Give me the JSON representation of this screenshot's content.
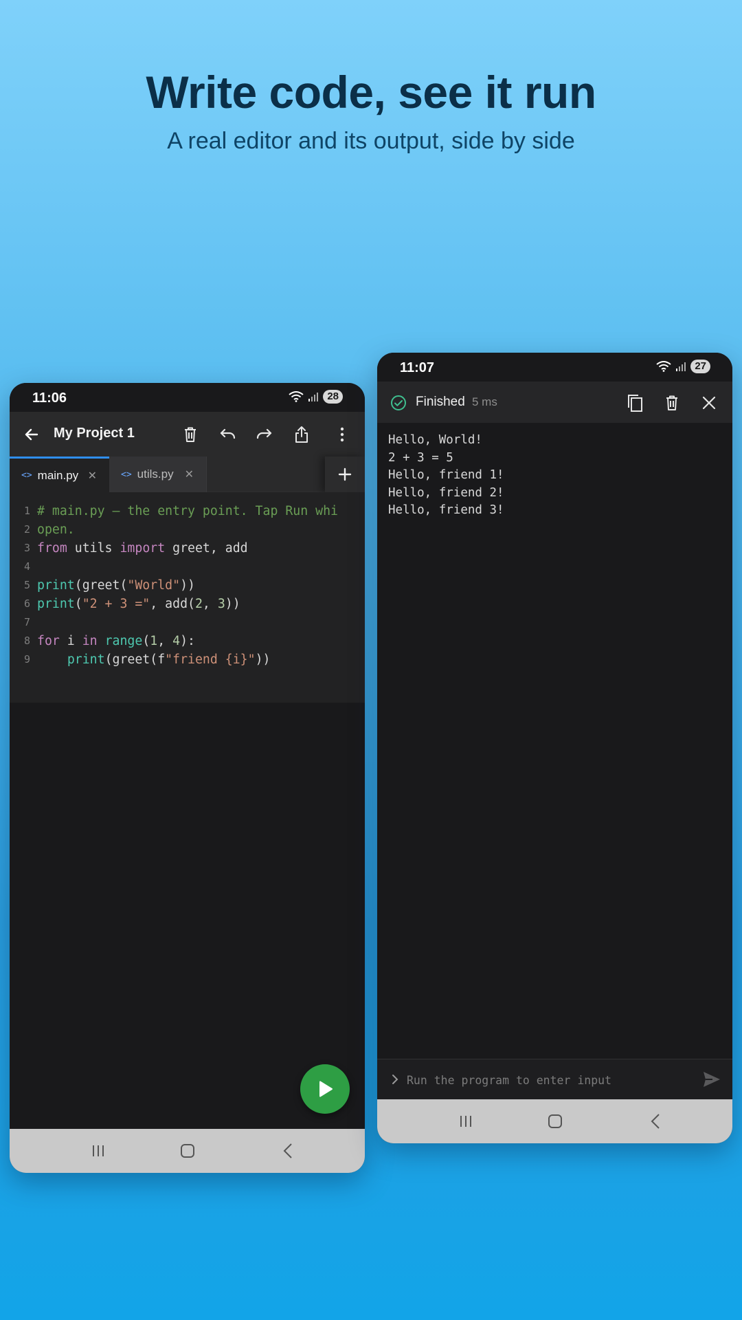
{
  "hero": {
    "title": "Write code, see it run",
    "subtitle": "A real editor and its output, side by side"
  },
  "editor_phone": {
    "status_time": "11:06",
    "battery": "28",
    "project_title": "My Project 1",
    "toolbar_icons": [
      "back-arrow-icon",
      "trash-icon",
      "undo-icon",
      "redo-icon",
      "share-icon",
      "more-vert-icon"
    ],
    "tabs": [
      {
        "label": "main.py",
        "active": true
      },
      {
        "label": "utils.py",
        "active": false
      }
    ],
    "code_lines": [
      {
        "n": "1",
        "tokens": [
          {
            "t": "# main.py — the entry point. Tap Run whi",
            "c": "c-comment"
          }
        ]
      },
      {
        "n": "2",
        "tokens": [
          {
            "t": "open.",
            "c": "c-comment"
          }
        ]
      },
      {
        "n": "3",
        "tokens": [
          {
            "t": "from",
            "c": "c-kw"
          },
          {
            "t": " utils ",
            "c": "c-plain"
          },
          {
            "t": "import",
            "c": "c-kw"
          },
          {
            "t": " greet, add",
            "c": "c-plain"
          }
        ]
      },
      {
        "n": "4",
        "tokens": []
      },
      {
        "n": "5",
        "tokens": [
          {
            "t": "print",
            "c": "c-fn"
          },
          {
            "t": "(greet(",
            "c": "c-plain"
          },
          {
            "t": "\"World\"",
            "c": "c-str"
          },
          {
            "t": "))",
            "c": "c-plain"
          }
        ]
      },
      {
        "n": "6",
        "tokens": [
          {
            "t": "print",
            "c": "c-fn"
          },
          {
            "t": "(",
            "c": "c-plain"
          },
          {
            "t": "\"2 + 3 =\"",
            "c": "c-str"
          },
          {
            "t": ", add(",
            "c": "c-plain"
          },
          {
            "t": "2",
            "c": "c-num"
          },
          {
            "t": ", ",
            "c": "c-plain"
          },
          {
            "t": "3",
            "c": "c-num"
          },
          {
            "t": "))",
            "c": "c-plain"
          }
        ]
      },
      {
        "n": "7",
        "tokens": []
      },
      {
        "n": "8",
        "tokens": [
          {
            "t": "for",
            "c": "c-kw"
          },
          {
            "t": " i ",
            "c": "c-plain"
          },
          {
            "t": "in",
            "c": "c-kw"
          },
          {
            "t": " ",
            "c": "c-plain"
          },
          {
            "t": "range",
            "c": "c-fn"
          },
          {
            "t": "(",
            "c": "c-plain"
          },
          {
            "t": "1",
            "c": "c-num"
          },
          {
            "t": ", ",
            "c": "c-plain"
          },
          {
            "t": "4",
            "c": "c-num"
          },
          {
            "t": "):",
            "c": "c-plain"
          }
        ]
      },
      {
        "n": "9",
        "tokens": [
          {
            "t": "    ",
            "c": "c-plain"
          },
          {
            "t": "print",
            "c": "c-fn"
          },
          {
            "t": "(greet(f",
            "c": "c-plain"
          },
          {
            "t": "\"friend {i}\"",
            "c": "c-str"
          },
          {
            "t": "))",
            "c": "c-plain"
          }
        ]
      }
    ],
    "run_button_icon": "play-icon"
  },
  "output_phone": {
    "status_time": "11:07",
    "battery": "27",
    "status_text": "Finished",
    "elapsed": "5 ms",
    "header_icons": [
      "check-circle-icon",
      "copy-icon",
      "trash-icon",
      "close-icon"
    ],
    "output_lines": [
      "Hello, World!",
      "2 + 3 = 5",
      "Hello, friend 1!",
      "Hello, friend 2!",
      "Hello, friend 3!"
    ],
    "input_placeholder": "Run the program to enter input"
  },
  "colors": {
    "accent_blue": "#2f8ff0",
    "run_green": "#2e9e44",
    "success_green": "#3fbf8f"
  }
}
